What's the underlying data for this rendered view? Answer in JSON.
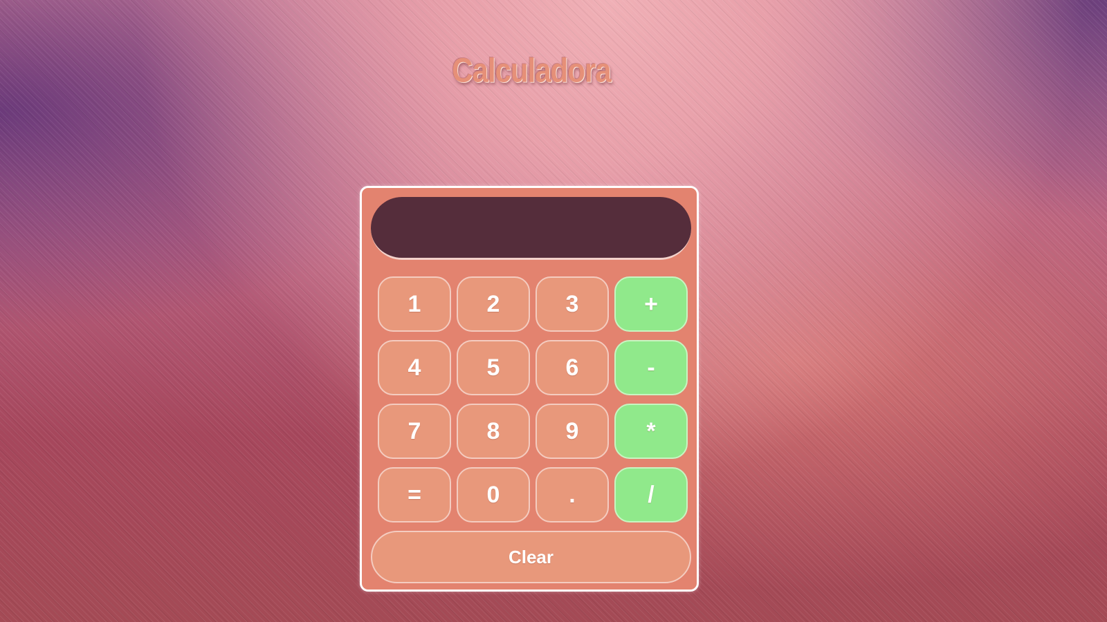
{
  "page": {
    "title": "Calculadora"
  },
  "calculator": {
    "display_value": "",
    "rows": [
      [
        {
          "label": "1",
          "kind": "digit"
        },
        {
          "label": "2",
          "kind": "digit"
        },
        {
          "label": "3",
          "kind": "digit"
        },
        {
          "label": "+",
          "kind": "operator"
        }
      ],
      [
        {
          "label": "4",
          "kind": "digit"
        },
        {
          "label": "5",
          "kind": "digit"
        },
        {
          "label": "6",
          "kind": "digit"
        },
        {
          "label": "-",
          "kind": "operator"
        }
      ],
      [
        {
          "label": "7",
          "kind": "digit"
        },
        {
          "label": "8",
          "kind": "digit"
        },
        {
          "label": "9",
          "kind": "digit"
        },
        {
          "label": "*",
          "kind": "operator"
        }
      ],
      [
        {
          "label": "=",
          "kind": "equals"
        },
        {
          "label": "0",
          "kind": "digit"
        },
        {
          "label": ".",
          "kind": "decimal"
        },
        {
          "label": "/",
          "kind": "operator"
        }
      ]
    ],
    "clear_label": "Clear"
  },
  "colors": {
    "panel": "#e3836f",
    "key": "#e8987b",
    "operator_key": "#90e98b",
    "display": "#552d3b",
    "title": "#e69078"
  }
}
